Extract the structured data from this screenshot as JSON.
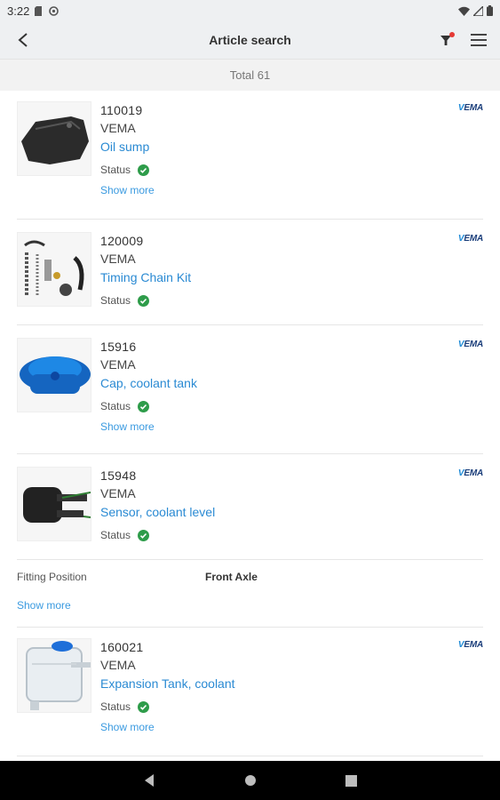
{
  "status_bar": {
    "time": "3:22"
  },
  "header": {
    "title": "Article search"
  },
  "total": {
    "label": "Total 61"
  },
  "brand_logo": {
    "text_v": "V",
    "text_rest": "EMA"
  },
  "articles": [
    {
      "number": "110019",
      "brand": "VEMA",
      "description": "Oil sump",
      "status_label": "Status",
      "show_more": "Show more"
    },
    {
      "number": "120009",
      "brand": "VEMA",
      "description": "Timing Chain Kit",
      "status_label": "Status"
    },
    {
      "number": "15916",
      "brand": "VEMA",
      "description": "Cap, coolant tank",
      "status_label": "Status",
      "show_more": "Show more"
    },
    {
      "number": "15948",
      "brand": "VEMA",
      "description": "Sensor, coolant level",
      "status_label": "Status"
    },
    {
      "number": "160021",
      "brand": "VEMA",
      "description": "Expansion Tank, coolant",
      "status_label": "Status",
      "show_more": "Show more"
    }
  ],
  "fitting": {
    "label": "Fitting Position",
    "value": "Front Axle",
    "show_more": "Show more"
  },
  "colors": {
    "accent": "#2a8ad3",
    "status_ok": "#2e9c4a",
    "header_bg": "#eef0f2"
  }
}
